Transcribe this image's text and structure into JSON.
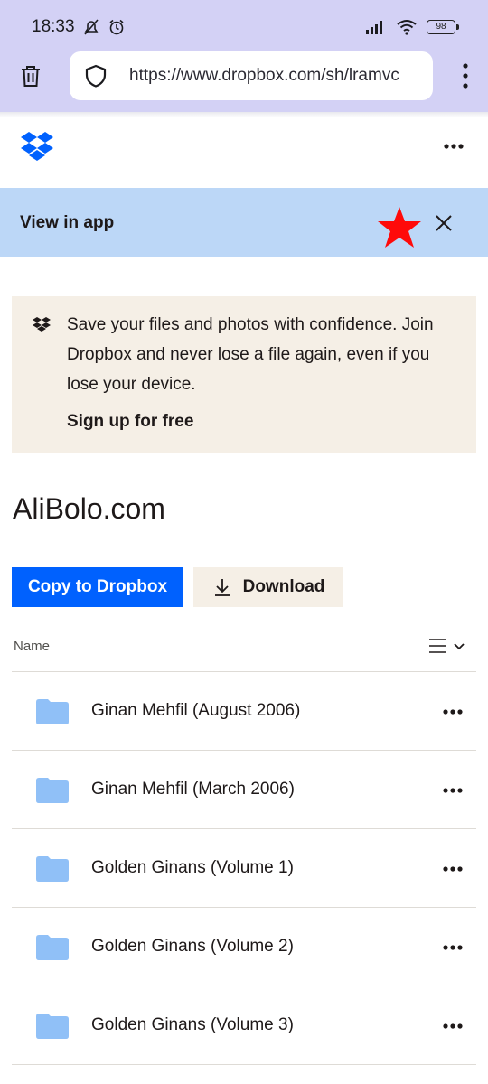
{
  "status_bar": {
    "time": "18:33",
    "battery": "98"
  },
  "browser": {
    "url": "https://www.dropbox.com/sh/lramvc"
  },
  "banner": {
    "label": "View in app"
  },
  "promo": {
    "text": "Save your files and photos with confidence. Join Dropbox and never lose a file again, even if you lose your device.",
    "signup": "Sign up for free"
  },
  "page": {
    "title": "AliBolo.com"
  },
  "actions": {
    "copy": "Copy to Dropbox",
    "download": "Download"
  },
  "list": {
    "header": "Name",
    "items": [
      {
        "name": "Ginan Mehfil (August 2006)"
      },
      {
        "name": "Ginan Mehfil (March 2006)"
      },
      {
        "name": "Golden Ginans (Volume 1)"
      },
      {
        "name": "Golden Ginans (Volume 2)"
      },
      {
        "name": "Golden Ginans (Volume 3)"
      }
    ]
  },
  "colors": {
    "accent": "#0061fe",
    "folder": "#90c0f7",
    "banner": "#bcd7f7",
    "promo_bg": "#f5efe6"
  }
}
